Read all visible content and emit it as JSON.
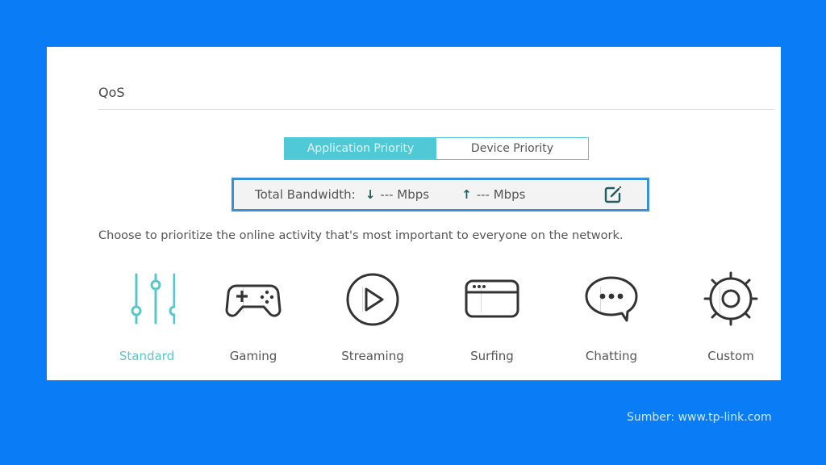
{
  "panel": {
    "title": "QoS",
    "priority_tabs": [
      {
        "label": "Application Priority",
        "active": true
      },
      {
        "label": "Device Priority",
        "active": false
      }
    ],
    "bandwidth": {
      "label": "Total Bandwidth:",
      "download_icon": "arrow-down-icon",
      "download_value": "--- Mbps",
      "upload_icon": "arrow-up-icon",
      "upload_value": "--- Mbps",
      "edit_icon": "edit-icon"
    },
    "description": "Choose to prioritize the online activity that's most important to everyone on the network.",
    "modes": [
      {
        "label": "Standard",
        "icon": "sliders-icon",
        "active": true
      },
      {
        "label": "Gaming",
        "icon": "gamepad-icon",
        "active": false
      },
      {
        "label": "Streaming",
        "icon": "play-circle-icon",
        "active": false
      },
      {
        "label": "Surfing",
        "icon": "browser-window-icon",
        "active": false
      },
      {
        "label": "Chatting",
        "icon": "chat-bubble-icon",
        "active": false
      },
      {
        "label": "Custom",
        "icon": "gear-icon",
        "active": false
      }
    ]
  },
  "source_caption": "Sumber: www.tp-link.com",
  "colors": {
    "background": "#0a7cf5",
    "accent": "#4fc9d6",
    "bandwidth_border": "#3b8fd6",
    "icon_dark": "#333333"
  }
}
